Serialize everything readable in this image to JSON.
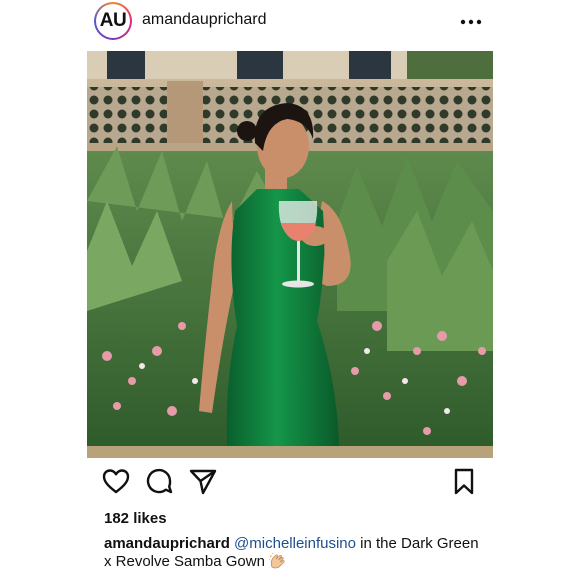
{
  "header": {
    "avatar_initials": "AU",
    "username": "amandauprichard",
    "more_icon": "more-horizontal-icon"
  },
  "post": {
    "image_subject": "photo",
    "actions": {
      "like_icon": "heart-icon",
      "comment_icon": "comment-icon",
      "share_icon": "share-icon",
      "save_icon": "bookmark-icon"
    },
    "likes_text": "182 likes",
    "caption": {
      "username": "amandauprichard",
      "mention": "@michelleinfusino",
      "text": " in the Dark Green x Revolve Samba Gown ",
      "emoji_icon": "clapping-hands-icon"
    }
  },
  "colors": {
    "dress_green": "#0e7a3a",
    "mention_blue": "#1f4e91",
    "avatar_ring": "#dd2a7b"
  }
}
